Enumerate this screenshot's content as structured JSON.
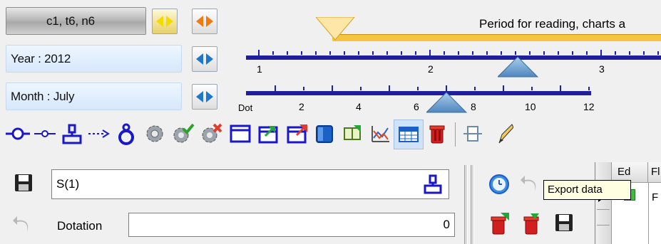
{
  "selectors": {
    "combo_label": "c1, t6, n6",
    "year_label": "Year : 2012",
    "month_label": "Month : July"
  },
  "timeline": {
    "banner_text": "Period for reading, charts a",
    "top_ruler_labels": [
      "1",
      "2",
      "3"
    ],
    "bottom_ruler_labels": [
      "Dot",
      "2",
      "4",
      "6",
      "8",
      "10",
      "12"
    ]
  },
  "toolbar": {
    "icons": [
      "node-icon",
      "small-node-icon",
      "structure-icon",
      "dotted-arrow-icon",
      "weight-icon",
      "gear-icon",
      "gear-check-icon",
      "gear-delete-icon",
      "window-icon",
      "window-import-icon",
      "window-export-icon",
      "cube-icon",
      "book-icon",
      "chart-icon",
      "table-icon",
      "trash-icon",
      "column-icon",
      "pencil-icon"
    ]
  },
  "form": {
    "name_value": "S(1)",
    "dotation_label": "Dotation",
    "dotation_value": "0"
  },
  "grid": {
    "col1_header": "Ed",
    "col2_header": "Fl",
    "cell_value": "F"
  },
  "tooltip": {
    "text": "Export data"
  },
  "colors": {
    "ruler": "#1f1e9c",
    "banner": "#f5c542",
    "marker": "#5a8fc0",
    "selector_blue": "#d6e8fb"
  }
}
